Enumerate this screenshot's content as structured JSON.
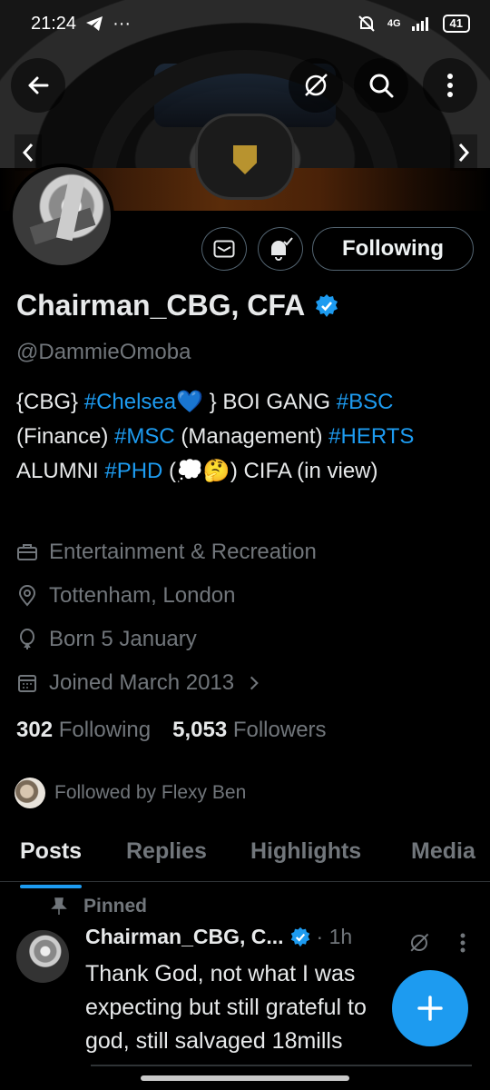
{
  "status_bar": {
    "time": "21:24",
    "network": "4G",
    "battery": "41"
  },
  "profile": {
    "name": "Chairman_CBG, CFA",
    "handle": "@DammieOmoba",
    "bio_segments": [
      {
        "text": "{CBG} ",
        "tag": false
      },
      {
        "text": "#Chelsea",
        "tag": true
      },
      {
        "text": "💙 } BOI GANG ",
        "tag": false
      },
      {
        "text": "#BSC",
        "tag": true
      },
      {
        "text": " (Finance) ",
        "tag": false
      },
      {
        "text": "#MSC",
        "tag": true
      },
      {
        "text": " (Management) ",
        "tag": false
      },
      {
        "text": "#HERTS",
        "tag": true
      },
      {
        "text": " ALUMNI ",
        "tag": false
      },
      {
        "text": "#PHD",
        "tag": true
      },
      {
        "text": " (💭🤔) CIFA (in view)",
        "tag": false
      }
    ],
    "category": "Entertainment & Recreation",
    "location": "Tottenham, London",
    "birthday": "Born 5 January",
    "joined": "Joined March 2013",
    "following_count": "302",
    "following_label": "Following",
    "followers_count": "5,053",
    "followers_label": "Followers",
    "followed_by": "Followed by Flexy Ben",
    "follow_button": "Following"
  },
  "tabs": [
    "Posts",
    "Replies",
    "Highlights",
    "Media"
  ],
  "pinned_post": {
    "pinned_label": "Pinned",
    "author": "Chairman_CBG, C...",
    "time": "· 1h",
    "text": "Thank God, not what I was expecting but still grateful to god, still salvaged 18mills"
  },
  "colors": {
    "accent": "#1d9bf0",
    "muted": "#71767b",
    "text": "#e7e9ea",
    "background": "#000000"
  }
}
